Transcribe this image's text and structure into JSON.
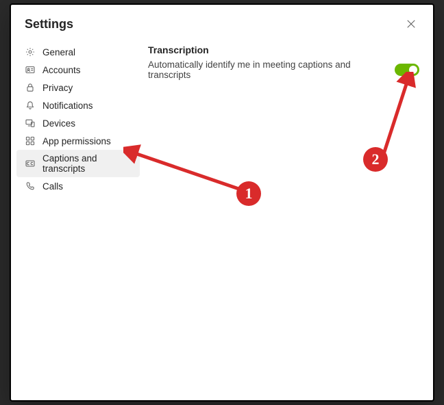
{
  "header": {
    "title": "Settings"
  },
  "sidebar": {
    "items": [
      {
        "id": "general",
        "label": "General",
        "icon": "gear-icon"
      },
      {
        "id": "accounts",
        "label": "Accounts",
        "icon": "accounts-icon"
      },
      {
        "id": "privacy",
        "label": "Privacy",
        "icon": "lock-icon"
      },
      {
        "id": "notifications",
        "label": "Notifications",
        "icon": "bell-icon"
      },
      {
        "id": "devices",
        "label": "Devices",
        "icon": "devices-icon"
      },
      {
        "id": "app-permissions",
        "label": "App permissions",
        "icon": "apps-icon"
      },
      {
        "id": "captions-transcripts",
        "label": "Captions and transcripts",
        "icon": "cc-icon",
        "selected": true
      },
      {
        "id": "calls",
        "label": "Calls",
        "icon": "phone-icon"
      }
    ]
  },
  "content": {
    "section_title": "Transcription",
    "setting_desc": "Automatically identify me in meeting captions and transcripts",
    "toggle_on": true
  },
  "annotations": {
    "badge1": "1",
    "badge2": "2",
    "color": "#d92b2b"
  }
}
